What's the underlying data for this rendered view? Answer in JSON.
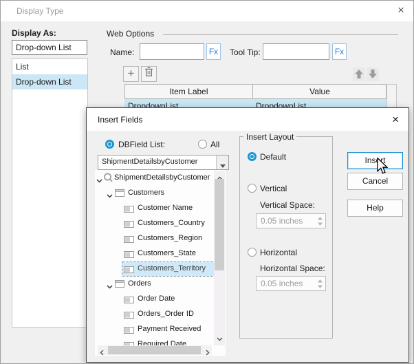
{
  "icons": {
    "close_glyph": "×",
    "add_glyph": "+"
  },
  "colors": {
    "accent_blue": "#1b95d2",
    "selection_blue": "#cde8f6",
    "fx_blue": "#2f7fd6",
    "focus_border": "#1f8fd6",
    "dialog_bg": "#f0f0f0"
  },
  "display_type": {
    "title": "Display Type",
    "display_as_label": "Display As:",
    "display_as_value": "Drop-down List",
    "type_list": {
      "items": [
        {
          "label": "List",
          "selected": false
        },
        {
          "label": "Drop-down List",
          "selected": true
        }
      ]
    },
    "web_options": {
      "group_label": "Web Options",
      "name_label": "Name:",
      "name_value": "",
      "name_placeholder": "",
      "tooltip_label": "Tool Tip:",
      "tooltip_value": "",
      "tooltip_placeholder": "",
      "fx_label": "Fx"
    },
    "items_table": {
      "headers": {
        "item_label": "Item Label",
        "value": "Value"
      },
      "rows": [
        {
          "item_label": "DropdownList",
          "value": "DropdownList",
          "selected": true
        }
      ]
    }
  },
  "insert_fields": {
    "title": "Insert Fields",
    "source_radios": {
      "dbfield_label": "DBField List:",
      "all_label": "All",
      "selected": "DBField List:"
    },
    "datasource_dropdown": {
      "value": "ShipmentDetailsbyCustomer"
    },
    "tree": {
      "items": [
        {
          "label": "ShipmentDetailsbyCustomer",
          "type": "query",
          "level": 0,
          "expanded": true,
          "selected": false
        },
        {
          "label": "Customers",
          "type": "table",
          "level": 1,
          "expanded": true,
          "selected": false
        },
        {
          "label": "Customer Name",
          "type": "field",
          "level": 2,
          "selected": false
        },
        {
          "label": "Customers_Country",
          "type": "field",
          "level": 2,
          "selected": false
        },
        {
          "label": "Customers_Region",
          "type": "field",
          "level": 2,
          "selected": false
        },
        {
          "label": "Customers_State",
          "type": "field",
          "level": 2,
          "selected": false
        },
        {
          "label": "Customers_Territory",
          "type": "field",
          "level": 2,
          "selected": true
        },
        {
          "label": "Orders",
          "type": "table",
          "level": 1,
          "expanded": true,
          "selected": false
        },
        {
          "label": "Order Date",
          "type": "field",
          "level": 2,
          "selected": false
        },
        {
          "label": "Orders_Order ID",
          "type": "field",
          "level": 2,
          "selected": false
        },
        {
          "label": "Payment Received",
          "type": "field",
          "level": 2,
          "selected": false
        },
        {
          "label": "Required Date",
          "type": "field",
          "level": 2,
          "selected": false
        }
      ]
    },
    "insert_layout": {
      "group_label": "Insert Layout",
      "default_label": "Default",
      "vertical_label": "Vertical",
      "vertical_space_label": "Vertical Space:",
      "vertical_space_value": "0.05 inches",
      "horizontal_label": "Horizontal",
      "horizontal_space_label": "Horizontal Space:",
      "horizontal_space_value": "0.05 inches",
      "selected": "Default"
    },
    "buttons": {
      "insert": "Insert",
      "cancel": "Cancel",
      "help": "Help"
    }
  }
}
